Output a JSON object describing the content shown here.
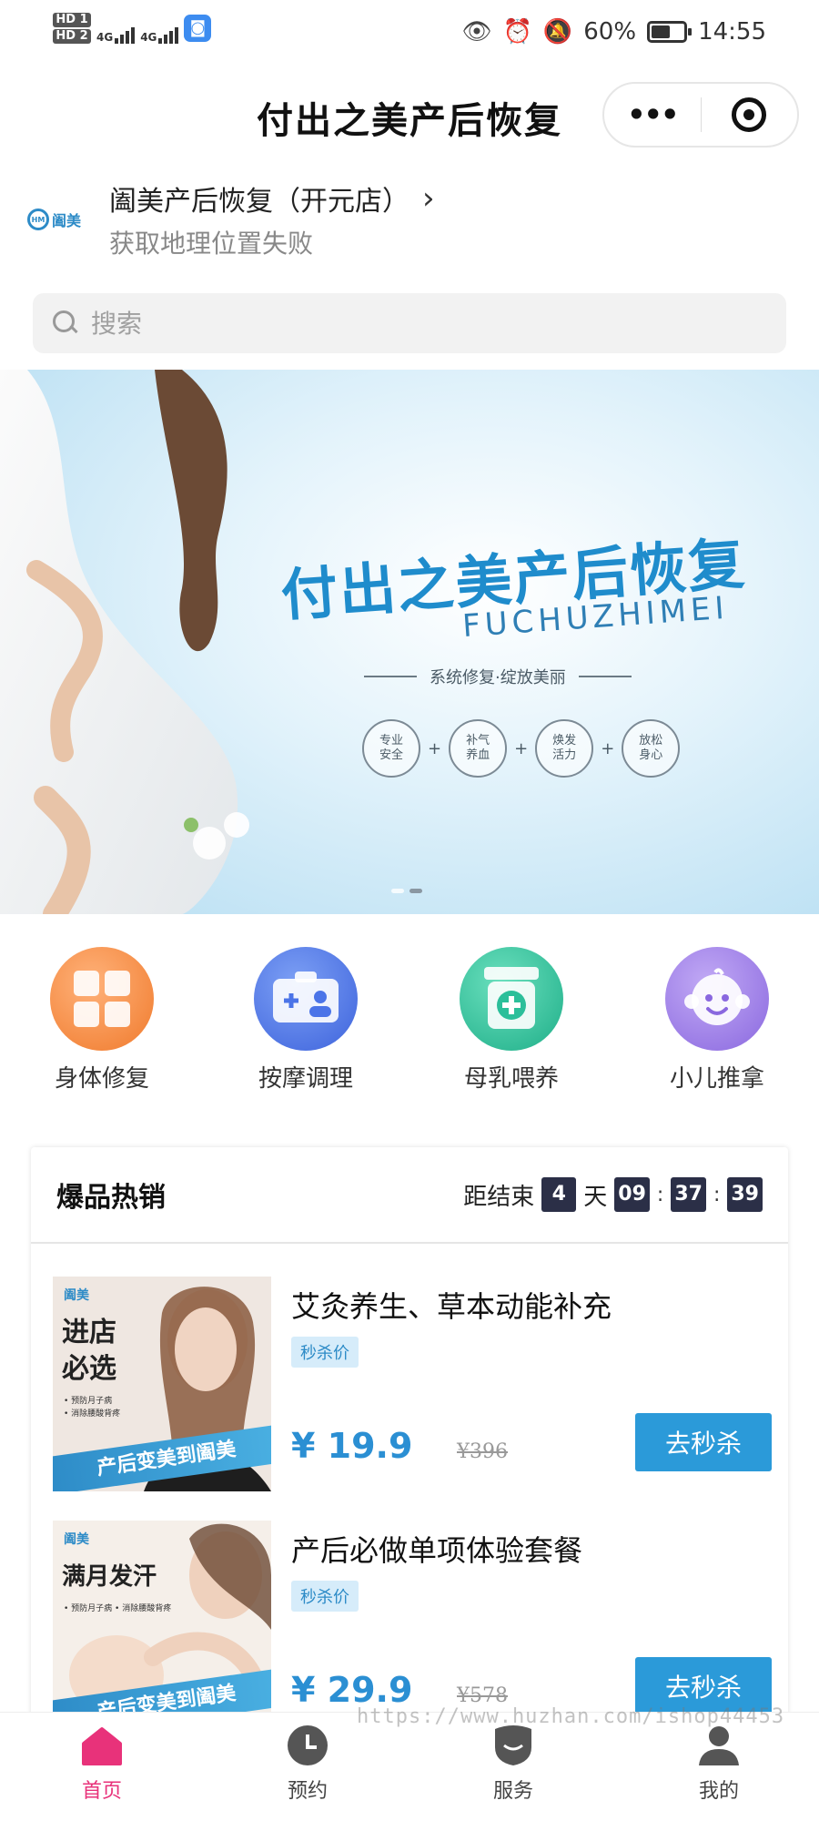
{
  "status_bar": {
    "hd1": "HD 1",
    "hd2": "HD 2",
    "net1": "4G",
    "net2": "4G",
    "battery_text": "60%",
    "battery_level": 0.6,
    "time": "14:55"
  },
  "header": {
    "title": "付出之美产后恢复",
    "more_label": "•••"
  },
  "store": {
    "logo_text": "阖美",
    "name": "阖美产后恢复（开元店）",
    "arrow": "›",
    "location_status": "获取地理位置失败"
  },
  "search": {
    "placeholder": "搜索"
  },
  "banner": {
    "title": "付出之美产后恢复",
    "pinyin": "FUCHUZHIMEI",
    "slogan": "系统修复·绽放美丽",
    "badges": [
      "专业\n安全",
      "补气\n养血",
      "焕发\n活力",
      "放松\n身心"
    ],
    "slide_count": 2,
    "active_slide": 2
  },
  "categories": [
    {
      "label": "身体修复",
      "icon": "body-repair-icon",
      "color": "#f28a3c"
    },
    {
      "label": "按摩调理",
      "icon": "massage-icon",
      "color": "#4b74e8"
    },
    {
      "label": "母乳喂养",
      "icon": "breastfeeding-icon",
      "color": "#2bbf9a"
    },
    {
      "label": "小儿推拿",
      "icon": "baby-massage-icon",
      "color": "#9a7be6"
    }
  ],
  "hot_sale": {
    "title": "爆品热销",
    "countdown_label": "距结束",
    "days": "4",
    "days_unit": "天",
    "hours": "09",
    "minutes": "37",
    "seconds": "39",
    "products": [
      {
        "name": "艾灸养生、草本动能补充",
        "tag": "秒杀价",
        "price": "¥ 19.9",
        "original_price": "¥396",
        "button": "去秒杀",
        "image_logo": "阖美",
        "image_title": "进店\n必选",
        "image_bullets": "• 预防月子病\n• 消除腰酸背疼",
        "image_ribbon": "产后变美到阖美"
      },
      {
        "name": "产后必做单项体验套餐",
        "tag": "秒杀价",
        "price": "¥ 29.9",
        "original_price": "¥578",
        "button": "去秒杀",
        "image_logo": "阖美",
        "image_title": "满月发汗",
        "image_bullets": "• 预防月子病\n• 消除腰酸背疼",
        "image_ribbon": "产后变美到阖美"
      }
    ]
  },
  "watermark": "https://www.huzhan.com/ishop44453",
  "tabbar": {
    "tabs": [
      {
        "label": "首页",
        "icon": "home-icon",
        "active": true
      },
      {
        "label": "预约",
        "icon": "clock-icon",
        "active": false
      },
      {
        "label": "服务",
        "icon": "service-icon",
        "active": false
      },
      {
        "label": "我的",
        "icon": "profile-icon",
        "active": false
      }
    ],
    "active_color": "#e8327a",
    "inactive_color": "#555555"
  }
}
